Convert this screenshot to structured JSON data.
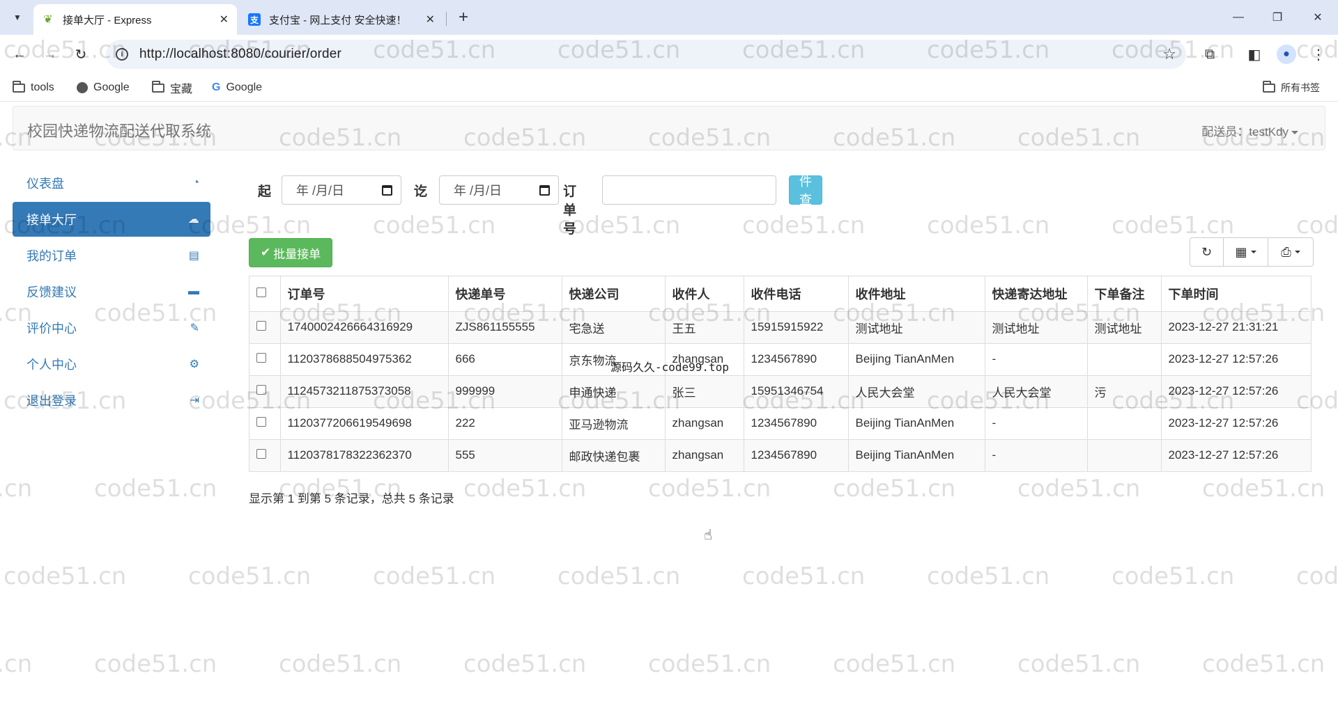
{
  "browser": {
    "tabs": [
      {
        "title": "接单大厅 - Express",
        "active": true,
        "favicon": "leaf-icon"
      },
      {
        "title": "支付宝 - 网上支付 安全快速！",
        "active": false,
        "favicon": "alipay-icon"
      }
    ],
    "url": "http://localhost:8080/courier/order",
    "bookmarks": [
      {
        "label": "tools",
        "icon": "folder-icon"
      },
      {
        "label": "Google",
        "icon": "globe-icon"
      },
      {
        "label": "宝藏",
        "icon": "folder-icon"
      },
      {
        "label": "Google",
        "icon": "google-icon"
      }
    ],
    "all_bookmarks": "所有书签"
  },
  "app": {
    "brand": "校园快递物流配送代取系统",
    "user_label": "配送员：",
    "username": "testKdy"
  },
  "sidebar": {
    "items": [
      {
        "label": "仪表盘",
        "icon": "dashboard-icon",
        "active": false
      },
      {
        "label": "接单大厅",
        "icon": "cloud-download-icon",
        "active": true
      },
      {
        "label": "我的订单",
        "icon": "list-icon",
        "active": false
      },
      {
        "label": "反馈建议",
        "icon": "comment-icon",
        "active": false
      },
      {
        "label": "评价中心",
        "icon": "edit-icon",
        "active": false
      },
      {
        "label": "个人中心",
        "icon": "gear-icon",
        "active": false
      },
      {
        "label": "退出登录",
        "icon": "logout-icon",
        "active": false
      }
    ]
  },
  "filters": {
    "from_label": "起",
    "to_label": "讫",
    "date_placeholder": "年 /月/日",
    "order_label": "订单号",
    "order_value": "",
    "query_button": "条件查询"
  },
  "toolbar": {
    "batch_button": "批量接单"
  },
  "table": {
    "columns": [
      "订单号",
      "快递单号",
      "快递公司",
      "收件人",
      "收件电话",
      "收件地址",
      "快递寄达地址",
      "下单备注",
      "下单时间"
    ],
    "rows": [
      [
        "1740002426664316929",
        "ZJS861155555",
        "宅急送",
        "王五",
        "15915915922",
        "测试地址",
        "测试地址",
        "测试地址",
        "2023-12-27 21:31:21"
      ],
      [
        "1120378688504975362",
        "666",
        "京东物流",
        "zhangsan",
        "1234567890",
        "Beijing TianAnMen",
        "-",
        "",
        "2023-12-27 12:57:26"
      ],
      [
        "1124573211875373058",
        "999999",
        "申通快递",
        "张三",
        "15951346754",
        "人民大会堂",
        "人民大会堂",
        "污",
        "2023-12-27 12:57:26"
      ],
      [
        "1120377206619549698",
        "222",
        "亚马逊物流",
        "zhangsan",
        "1234567890",
        "Beijing TianAnMen",
        "-",
        "",
        "2023-12-27 12:57:26"
      ],
      [
        "1120378178322362370",
        "555",
        "邮政快递包裹",
        "zhangsan",
        "1234567890",
        "Beijing TianAnMen",
        "-",
        "",
        "2023-12-27 12:57:26"
      ]
    ]
  },
  "pagination": {
    "info": "显示第 1 到第 5 条记录，总共 5 条记录"
  },
  "overlay": "源码久久-code99.top",
  "watermark_text": "code51.cn"
}
